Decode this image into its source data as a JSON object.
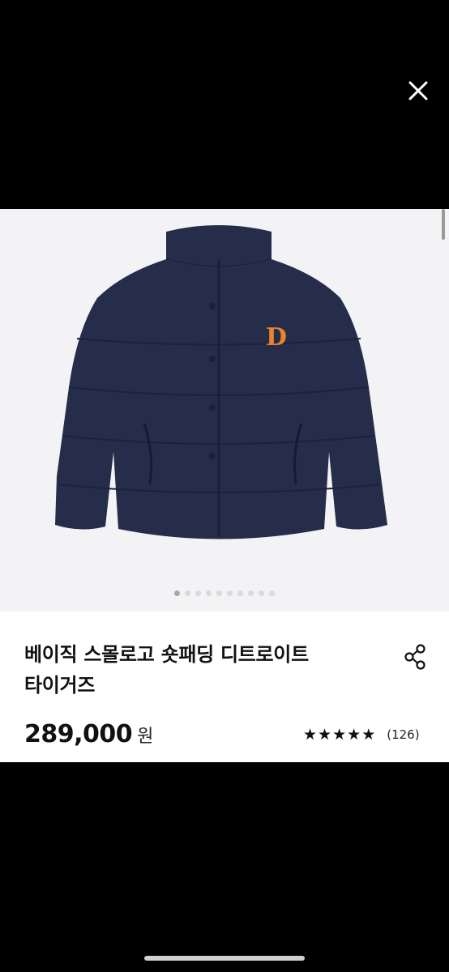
{
  "header": {
    "close_icon": "close-icon"
  },
  "product": {
    "title_line1": "베이직 스몰로고 숏패딩 디트로이트",
    "title_line2": "타이거즈",
    "price": "289,000",
    "currency": "원",
    "rating": 5,
    "review_count": "(126)",
    "logo_letter": "D"
  },
  "gallery": {
    "image_count": 10,
    "active_index": 0
  },
  "colors": {
    "jacket": "#262d4a",
    "logo": "#e8842a",
    "background": "#f3f3f5"
  }
}
